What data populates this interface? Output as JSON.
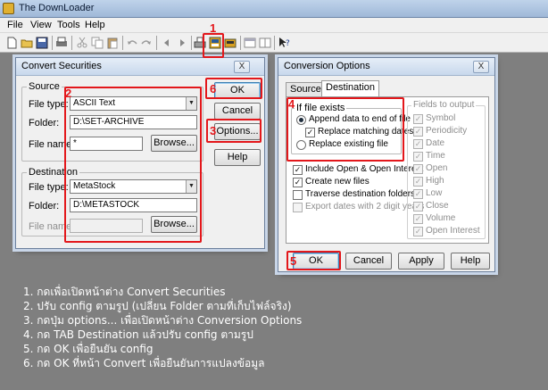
{
  "app": {
    "title": "The DownLoader",
    "menu": [
      "File",
      "View",
      "Tools",
      "Help"
    ],
    "colors": {
      "annotation": "#e3171b",
      "workspace": "#7f7f7f"
    }
  },
  "toolbar": {
    "icons": [
      "new-file-icon",
      "open-folder-icon",
      "save-icon",
      "print-icon",
      "cut-icon",
      "copy-icon",
      "paste-icon",
      "undo-icon",
      "redo-icon",
      "back-icon",
      "forward-icon",
      "download-icon",
      "convert-securities-icon",
      "convert-icon",
      "window-icon",
      "window-icon-2",
      "context-help-icon"
    ]
  },
  "convert_dialog": {
    "title": "Convert Securities",
    "close": "X",
    "source": {
      "label": "Source",
      "file_type_label": "File type:",
      "file_type_value": "ASCII Text",
      "folder_label": "Folder:",
      "folder_value": "D:\\SET-ARCHIVE",
      "file_name_label": "File name:",
      "file_name_value": "*",
      "browse": "Browse..."
    },
    "destination": {
      "label": "Destination",
      "file_type_label": "File type:",
      "file_type_value": "MetaStock",
      "folder_label": "Folder:",
      "folder_value": "D:\\METASTOCK",
      "file_name_label": "File name:",
      "file_name_value": "",
      "browse": "Browse..."
    },
    "buttons": {
      "ok": "OK",
      "cancel": "Cancel",
      "options": "Options...",
      "help": "Help"
    }
  },
  "options_dialog": {
    "title": "Conversion Options",
    "close": "X",
    "tabs": [
      "Source",
      "Destination"
    ],
    "if_file_exists": {
      "label": "If file exists",
      "append": "Append data to end of file",
      "replace_matching": "Replace matching dates",
      "replace_existing": "Replace existing file"
    },
    "include_open_interest": "Include Open & Open Interest",
    "create_new_files": "Create new files",
    "traverse_folders": "Traverse destination folders",
    "export_dates": "Export dates with 2 digit years",
    "fields_label": "Fields to output",
    "fields": [
      "Symbol",
      "Periodicity",
      "Date",
      "Time",
      "Open",
      "High",
      "Low",
      "Close",
      "Volume",
      "Open Interest"
    ],
    "buttons": {
      "ok": "OK",
      "cancel": "Cancel",
      "apply": "Apply",
      "help": "Help"
    }
  },
  "annotations": [
    "1",
    "2",
    "3",
    "4",
    "5",
    "6"
  ],
  "instructions": [
    "1. กดเพื่อเปิดหน้าต่าง Convert Securities",
    "2. ปรับ config ตามรูป (เปลี่ยน Folder ตามที่เก็บไฟล์จริง)",
    "3. กดปุ่ม options... เพื่อเปิดหน้าต่าง Conversion Options",
    "4. กด TAB Destination แล้วปรับ config ตามรูป",
    "5. กด OK เพื่อยืนยัน config",
    "6. กด OK ที่หน้า Convert เพื่อยืนยันการแปลงข้อมูล"
  ]
}
